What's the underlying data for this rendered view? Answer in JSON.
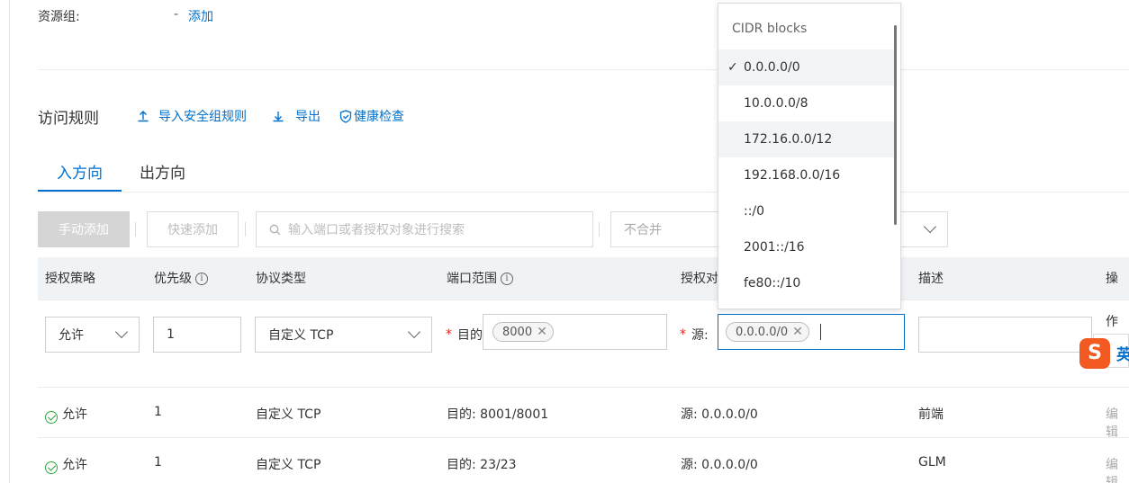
{
  "resource_group": {
    "label": "资源组:",
    "value": "-",
    "add_link": "添加"
  },
  "rules_header": {
    "title": "访问规则",
    "import_label": "导入安全组规则",
    "export_label": "导出",
    "health_label": "健康检查"
  },
  "tabs": [
    {
      "label": "入方向",
      "active": true
    },
    {
      "label": "出方向",
      "active": false
    }
  ],
  "toolbar": {
    "manual_add": "手动添加",
    "quick_add": "快速添加",
    "search_placeholder": "输入端口或者授权对象进行搜索",
    "merge_select": "不合并"
  },
  "table": {
    "headers": {
      "policy": "授权策略",
      "priority": "优先级",
      "protocol": "协议类型",
      "port": "端口范围",
      "auth": "授权对",
      "desc": "描述",
      "ops": "操作"
    },
    "edit_row": {
      "policy": "允许",
      "priority": "1",
      "protocol": "自定义 TCP",
      "port_prefix": "目的",
      "port_tag": "8000",
      "source_prefix": "源:",
      "source_tag": "0.0.0.0/0"
    },
    "rows": [
      {
        "policy": "允许",
        "priority": "1",
        "protocol": "自定义 TCP",
        "port": "目的: 8001/8001",
        "source": "源: 0.0.0.0/0",
        "desc": "前端",
        "op": "编辑"
      },
      {
        "policy": "允许",
        "priority": "1",
        "protocol": "自定义 TCP",
        "port": "目的: 23/23",
        "source": "源: 0.0.0.0/0",
        "desc": "GLM",
        "op": "编辑"
      }
    ]
  },
  "cidr_dropdown": {
    "header": "CIDR blocks",
    "check": "✓",
    "items": [
      "0.0.0.0/0",
      "10.0.0.0/8",
      "172.16.0.0/12",
      "192.168.0.0/16",
      "::/0",
      "2001::/16",
      "fe80::/10"
    ],
    "selected_index": 0
  },
  "ime": {
    "logo": "S",
    "label": "英"
  },
  "colors": {
    "link": "#0070cc",
    "required": "#e1251b",
    "allow": "#2eaa3e",
    "focus": "#0070cc"
  }
}
